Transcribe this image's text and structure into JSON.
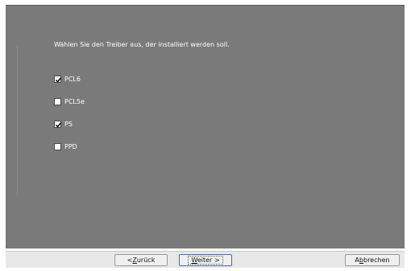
{
  "instruction": "Wählen Sie den Treiber aus, der installiert werden soll.",
  "drivers": [
    {
      "label": "PCL6",
      "checked": true
    },
    {
      "label": "PCL5e",
      "checked": false
    },
    {
      "label": "PS",
      "checked": true
    },
    {
      "label": "PPD",
      "checked": false
    }
  ],
  "buttons": {
    "back_prefix": "< ",
    "back_mnemonic": "Z",
    "back_rest": "urück",
    "next_mnemonic": "W",
    "next_rest": "eiter >",
    "cancel_prefix": "A",
    "cancel_mnemonic": "b",
    "cancel_rest": "brechen"
  }
}
